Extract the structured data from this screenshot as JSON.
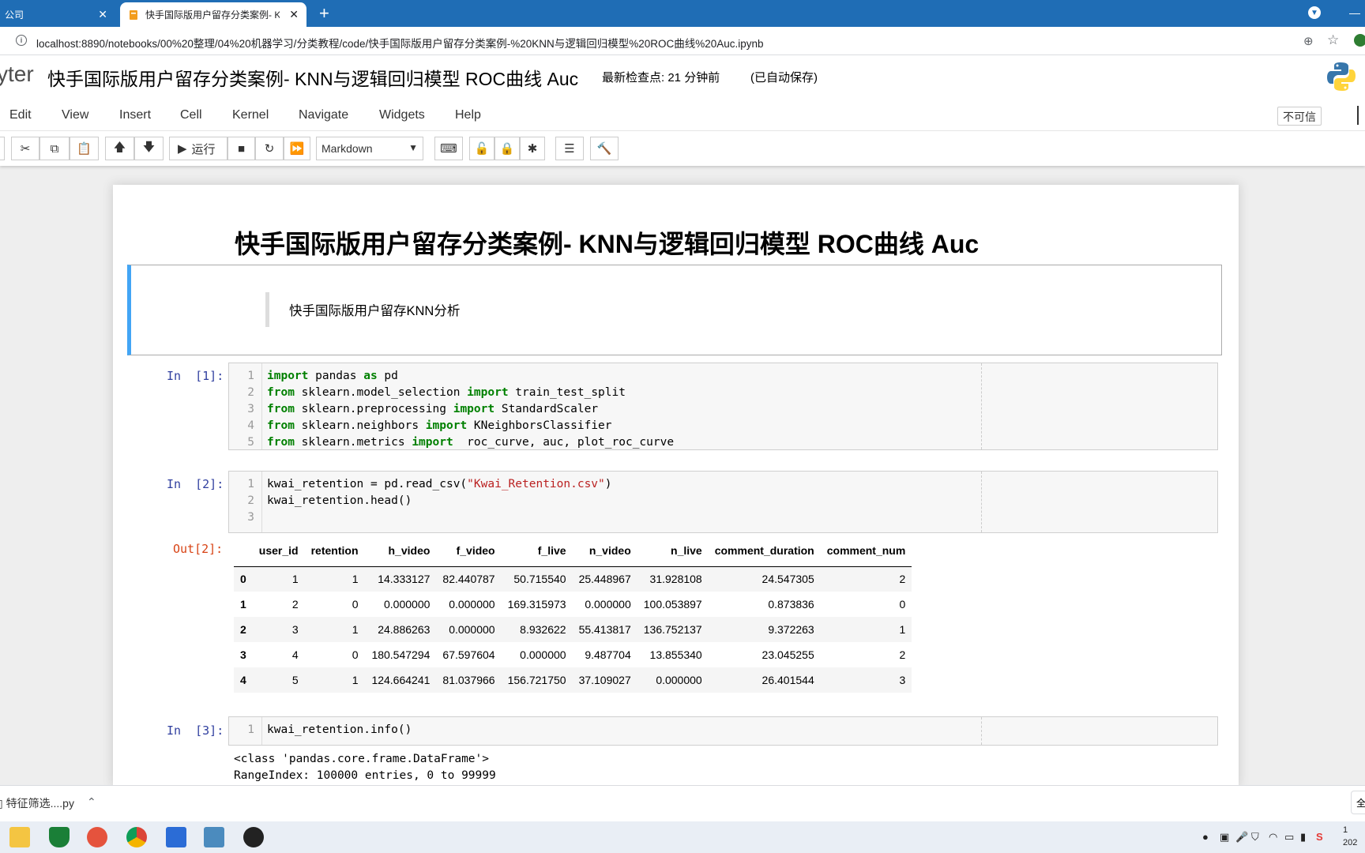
{
  "browser": {
    "tabs": [
      {
        "label": "公司",
        "active": false
      },
      {
        "label": "快手国际版用户留存分类案例- K",
        "active": true
      }
    ],
    "url": "localhost:8890/notebooks/00%20整理/04%20机器学习/分类教程/code/快手国际版用户留存分类案例-%20KNN与逻辑回归模型%20ROC曲线%20Auc.ipynb"
  },
  "jupyter": {
    "logo_text": "yter",
    "notebook_title": "快手国际版用户留存分类案例- KNN与逻辑回归模型 ROC曲线 Auc",
    "checkpoint": "最新检查点: 21 分钟前",
    "autosave": "(已自动保存)",
    "menu": [
      "Edit",
      "View",
      "Insert",
      "Cell",
      "Kernel",
      "Navigate",
      "Widgets",
      "Help"
    ],
    "trust_label": "不可信",
    "run_label": "运行",
    "cell_type": "Markdown"
  },
  "notebook": {
    "h1": "快手国际版用户留存分类案例- KNN与逻辑回归模型 ROC曲线 Auc",
    "blockquote": "快手国际版用户留存KNN分析",
    "cells": [
      {
        "prompt": "In  [1]:",
        "lines": [
          "import pandas as pd",
          "from sklearn.model_selection import train_test_split",
          "from sklearn.preprocessing import StandardScaler",
          "from sklearn.neighbors import KNeighborsClassifier",
          "from sklearn.metrics import  roc_curve, auc, plot_roc_curve"
        ]
      },
      {
        "prompt": "In  [2]:",
        "lines": [
          "kwai_retention = pd.read_csv(\"Kwai_Retention.csv\")",
          "kwai_retention.head()",
          ""
        ]
      },
      {
        "prompt": "In  [3]:",
        "lines": [
          "kwai_retention.info()"
        ]
      }
    ],
    "out2_prompt": "Out[2]:",
    "table": {
      "columns": [
        "",
        "user_id",
        "retention",
        "h_video",
        "f_video",
        "f_live",
        "n_video",
        "n_live",
        "comment_duration",
        "comment_num"
      ],
      "rows": [
        [
          "0",
          "1",
          "1",
          "14.333127",
          "82.440787",
          "50.715540",
          "25.448967",
          "31.928108",
          "24.547305",
          "2"
        ],
        [
          "1",
          "2",
          "0",
          "0.000000",
          "0.000000",
          "169.315973",
          "0.000000",
          "100.053897",
          "0.873836",
          "0"
        ],
        [
          "2",
          "3",
          "1",
          "24.886263",
          "0.000000",
          "8.932622",
          "55.413817",
          "136.752137",
          "9.372263",
          "1"
        ],
        [
          "3",
          "4",
          "0",
          "180.547294",
          "67.597604",
          "0.000000",
          "9.487704",
          "13.855340",
          "23.045255",
          "2"
        ],
        [
          "4",
          "5",
          "1",
          "124.664241",
          "81.037966",
          "156.721750",
          "37.109027",
          "0.000000",
          "26.401544",
          "3"
        ]
      ]
    },
    "info_output": [
      "<class 'pandas.core.frame.DataFrame'>",
      "RangeIndex: 100000 entries, 0 to 99999"
    ]
  },
  "downloads": {
    "item": "特征筛选....py",
    "show_all": "全"
  },
  "taskbar": {
    "clock_line1": "1",
    "clock_line2": "202"
  }
}
